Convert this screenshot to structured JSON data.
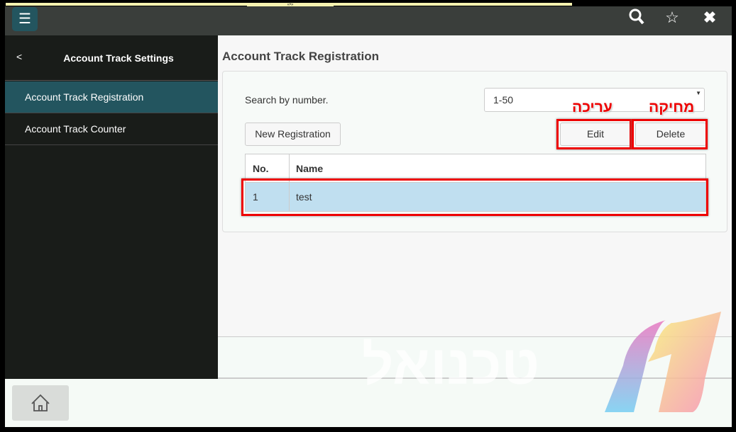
{
  "topbar": {
    "tab_label": "«•»",
    "menu_icon": "hamburger-icon",
    "icons": [
      "search-icon",
      "star-icon",
      "close-icon"
    ]
  },
  "sidebar": {
    "back": "<",
    "title": "Account Track Settings",
    "items": [
      {
        "label": "Account Track Registration",
        "selected": true
      },
      {
        "label": "Account Track Counter",
        "selected": false
      }
    ]
  },
  "main": {
    "title": "Account Track Registration",
    "search_label": "Search by number.",
    "range_value": "1-50",
    "new_label": "New Registration",
    "edit_label": "Edit",
    "delete_label": "Delete",
    "table": {
      "headers": [
        "No.",
        "Name"
      ],
      "rows": [
        {
          "no": "1",
          "name": "test",
          "selected": true
        }
      ]
    }
  },
  "annotations": {
    "edit": "עריכה",
    "delete": "מחיקה",
    "color": "#e00000"
  },
  "watermark": {
    "text": "טכנואל"
  },
  "bottom": {
    "home_icon": "home-icon"
  },
  "colors": {
    "accent": "#23555f",
    "selected_row": "#c0dff0"
  }
}
